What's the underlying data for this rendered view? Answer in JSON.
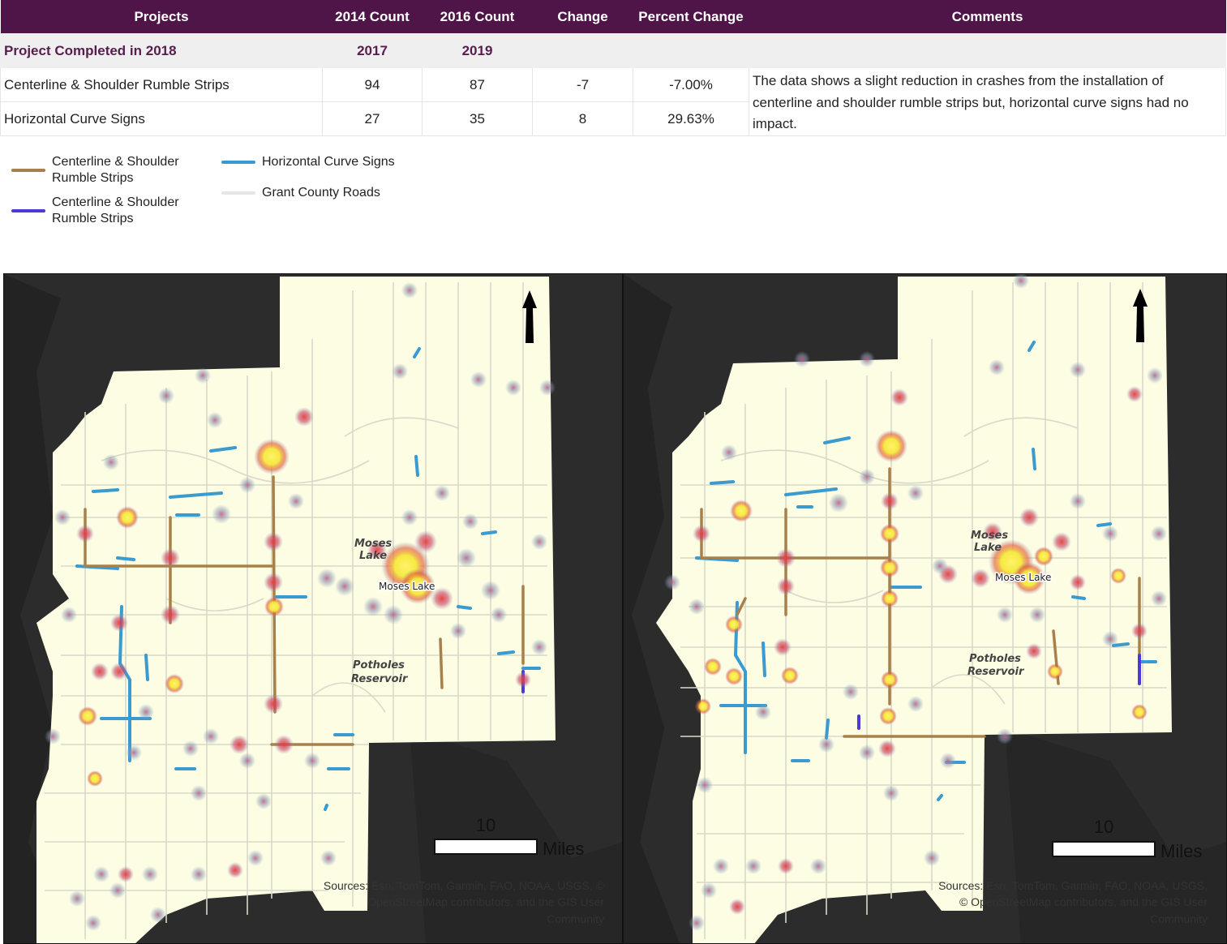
{
  "table": {
    "headers": [
      "Projects",
      "2014 Count",
      "2016 Count",
      "Change",
      "Percent Change",
      "Comments"
    ],
    "group_row": {
      "label": "Project Completed in 2018",
      "col1": "2017",
      "col2": "2019"
    },
    "rows": [
      {
        "project": "Centerline & Shoulder Rumble Strips",
        "count_a": "94",
        "count_b": "87",
        "change": "-7",
        "pct": "-7.00%"
      },
      {
        "project": "Horizontal Curve Signs",
        "count_a": "27",
        "count_b": "35",
        "change": "8",
        "pct": "29.63%"
      }
    ],
    "comment": "The data shows a slight reduction in crashes from the installation of centerline and shoulder rumble strips but, horizontal curve signs had no impact."
  },
  "legend": {
    "items": [
      {
        "label": "Centerline & Shoulder\nRumble Strips",
        "color": "#a8804a"
      },
      {
        "label": "Centerline & Shoulder\nRumble Strips",
        "color": "#4b3bd6"
      },
      {
        "label": "Horizontal Curve Signs",
        "color": "#3a9bd0"
      },
      {
        "label": "Grant County Roads",
        "color": "#dddddd"
      }
    ]
  },
  "maps": [
    {
      "id": "2017",
      "labels": {
        "city_top": "Moses",
        "city_bottom": "Lake",
        "place": "Moses Lake",
        "reservoir_top": "Potholes",
        "reservoir_bottom": "Reservoir"
      },
      "scale": {
        "value": "10",
        "unit": "Miles"
      },
      "attribution": [
        "Sources: Esri, TomTom, Garmin, FAO, NOAA, USGS, ©",
        "OpenStreetMap contributors, and the GIS User",
        "Community"
      ]
    },
    {
      "id": "2019",
      "labels": {
        "city_top": "Moses",
        "city_bottom": "Lake",
        "place": "Moses Lake",
        "reservoir_top": "Potholes",
        "reservoir_bottom": "Reservoir"
      },
      "scale": {
        "value": "10",
        "unit": "Miles"
      },
      "attribution": [
        "Sources: Esri, TomTom, Garmin, FAO, NOAA, USGS,",
        "© OpenStreetMap contributors, and the GIS User",
        "Community"
      ]
    }
  ],
  "colors": {
    "header_bg": "#4f1548",
    "group_text": "#5a1c4f",
    "land": "#fdfde4",
    "basemap": "#2c2c2c",
    "rumble": "#a8804a",
    "rumble_alt": "#4b3bd6",
    "curve_signs": "#3a9bd0",
    "hotspot_low": "#8f99b5",
    "hotspot_mid": "#d9413a",
    "hotspot_high": "#f5e83a"
  }
}
